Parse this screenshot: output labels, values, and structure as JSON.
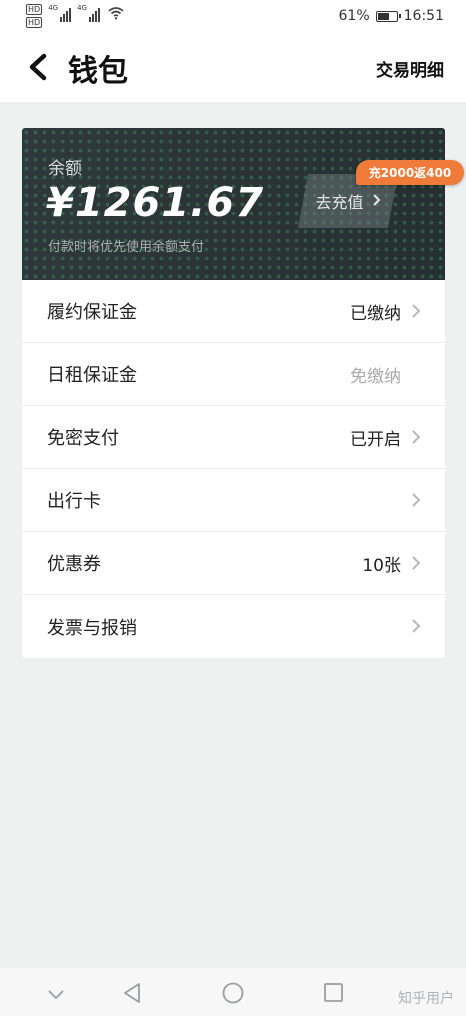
{
  "status_bar": {
    "hd_tags": [
      "HD",
      "HD"
    ],
    "network": [
      "4G",
      "4G"
    ],
    "battery_percent": "61%",
    "battery_level": 0.61,
    "time": "16:51"
  },
  "header": {
    "title": "钱包",
    "right_link": "交易明细"
  },
  "balance_card": {
    "label": "余额",
    "amount": "¥1261.67",
    "hint": "付款时将优先使用余额支付",
    "recharge_button": "去充值",
    "promo_badge": "充2000返400",
    "accent_color": "#f07a3a"
  },
  "list": {
    "items": [
      {
        "label": "履约保证金",
        "value": "已缴纳",
        "has_arrow": true
      },
      {
        "label": "日租保证金",
        "value": "免缴纳",
        "has_arrow": false
      },
      {
        "label": "免密支付",
        "value": "已开启",
        "has_arrow": true
      },
      {
        "label": "出行卡",
        "value": "",
        "has_arrow": true
      },
      {
        "label": "优惠券",
        "value": "10张",
        "has_arrow": true
      },
      {
        "label": "发票与报销",
        "value": "",
        "has_arrow": true
      }
    ]
  },
  "nav_bar": {
    "icons": [
      "chevron-down-icon",
      "back-triangle-icon",
      "home-circle-icon",
      "recents-square-icon"
    ],
    "watermark": "知乎用户"
  }
}
